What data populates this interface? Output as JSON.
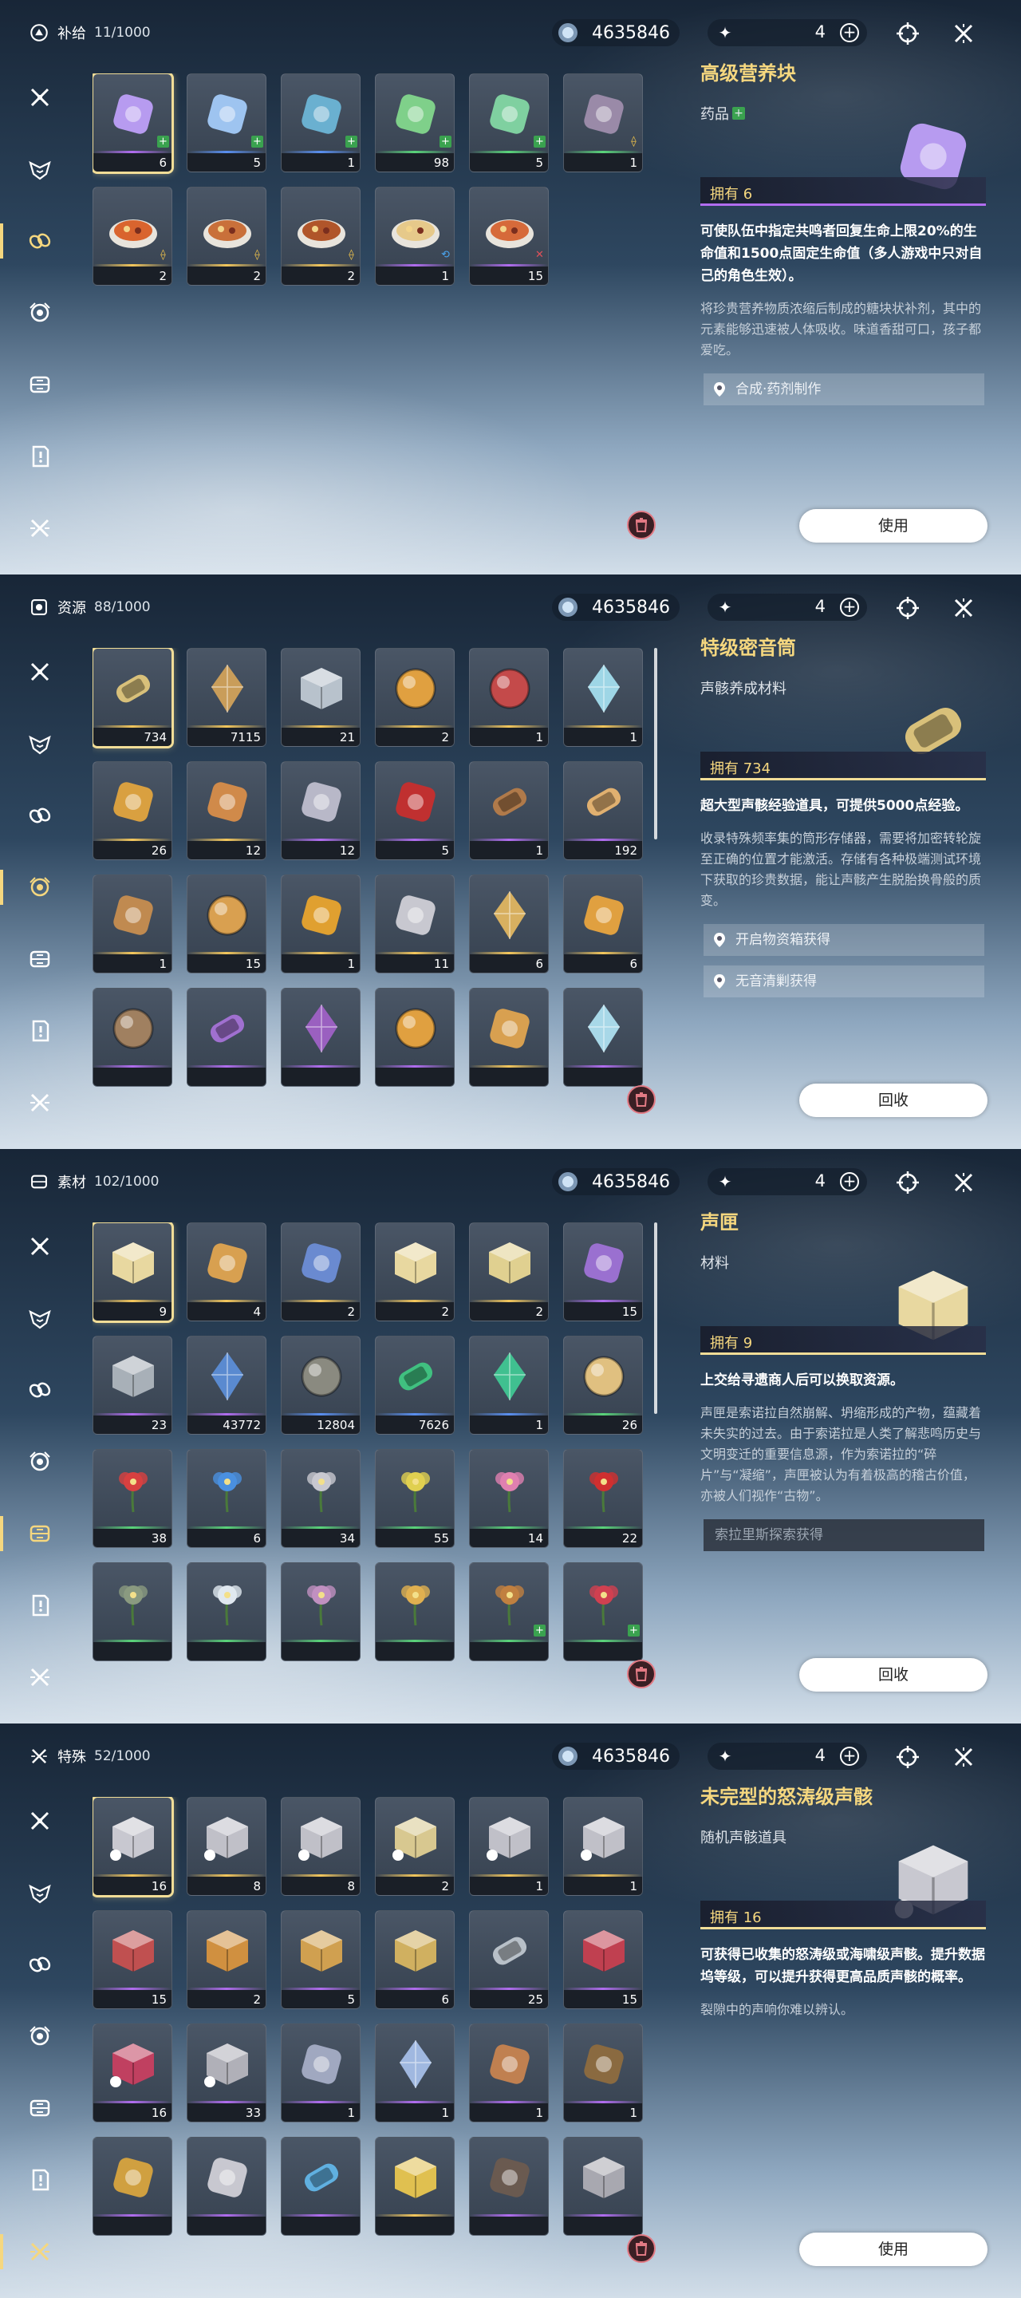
{
  "panels": [
    {
      "category": {
        "name": "补给",
        "count": "11/1000",
        "icon": "supply-icon"
      },
      "currency": {
        "credits": "4635846",
        "lunite": "4"
      },
      "active_tab": 2,
      "items": [
        {
          "icon": "purple-nutrient-block",
          "qty": "6",
          "rarity": 4,
          "badge": "plus",
          "color": "#b79bf0",
          "selected": true
        },
        {
          "icon": "blue-nutrient-block",
          "qty": "5",
          "rarity": 3,
          "badge": "plus",
          "color": "#9ec4f0"
        },
        {
          "icon": "medicine-pack",
          "qty": "1",
          "rarity": 3,
          "badge": "plus",
          "color": "#6ab0d0"
        },
        {
          "icon": "green-capsule",
          "qty": "98",
          "rarity": 2,
          "badge": "plus",
          "color": "#7fd08a"
        },
        {
          "icon": "green-nutrient-block",
          "qty": "5",
          "rarity": 2,
          "badge": "plus",
          "color": "#7fd0a0"
        },
        {
          "icon": "dark-gadget",
          "qty": "1",
          "rarity": 2,
          "badge": "coin",
          "color": "#9a8aa8"
        },
        {
          "icon": "spicy-dish",
          "qty": "2",
          "rarity": 5,
          "badge": "coin",
          "color": "#d9642e"
        },
        {
          "icon": "stir-fry-dish",
          "qty": "2",
          "rarity": 5,
          "badge": "coin",
          "color": "#c9703a"
        },
        {
          "icon": "meatball-dish",
          "qty": "2",
          "rarity": 5,
          "badge": "coin",
          "color": "#b0552a"
        },
        {
          "icon": "pastry-dish",
          "qty": "1",
          "rarity": 4,
          "badge": "blue",
          "color": "#e6c98a"
        },
        {
          "icon": "soup-dish",
          "qty": "15",
          "rarity": 4,
          "badge": "red",
          "color": "#d66a3a"
        }
      ],
      "detail": {
        "name": "高级营养块",
        "type": "药品",
        "type_plus": true,
        "owned": "拥有 6",
        "effect": "可使队伍中指定共鸣者回复生命上限20%的生命值和1500点固定生命值（多人游戏中只对自己的角色生效）。",
        "lore": "将珍贵营养物质浓缩后制成的糖块状补剂，其中的元素能够迅速被人体吸收。味道香甜可口，孩子都爱吃。",
        "sources": [
          {
            "label": "合成·药剂制作",
            "dark": false
          }
        ],
        "pic_color": "#b79bf0",
        "own_color": "purple"
      },
      "action": "使用",
      "show_scroll": false
    },
    {
      "category": {
        "name": "资源",
        "count": "88/1000",
        "icon": "resource-icon"
      },
      "currency": {
        "credits": "4635846",
        "lunite": "4"
      },
      "active_tab": 3,
      "items": [
        {
          "icon": "premium-sealed-tube",
          "qty": "734",
          "rarity": 5,
          "color": "#d8c07a",
          "selected": true
        },
        {
          "icon": "gold-crystal-gear",
          "qty": "7115",
          "rarity": 5,
          "color": "#c99d5a"
        },
        {
          "icon": "shell-credit-box",
          "qty": "21",
          "rarity": 5,
          "color": "#b8c2cc"
        },
        {
          "icon": "amber-orb",
          "qty": "2",
          "rarity": 5,
          "color": "#e0a040"
        },
        {
          "icon": "red-ring",
          "qty": "1",
          "rarity": 5,
          "color": "#c44a4a"
        },
        {
          "icon": "crystal-shard",
          "qty": "1",
          "rarity": 5,
          "color": "#9ed6e6"
        },
        {
          "icon": "gold-star-core",
          "qty": "26",
          "rarity": 5,
          "color": "#d9a040"
        },
        {
          "icon": "triangle-relic",
          "qty": "12",
          "rarity": 5,
          "color": "#d08a4a"
        },
        {
          "icon": "silver-crown",
          "qty": "12",
          "rarity": 4,
          "color": "#b8b8c8"
        },
        {
          "icon": "red-mechanism",
          "qty": "5",
          "rarity": 4,
          "color": "#c03030"
        },
        {
          "icon": "bronze-roll",
          "qty": "1",
          "rarity": 4,
          "color": "#b07a4a"
        },
        {
          "icon": "amber-vial",
          "qty": "192",
          "rarity": 4,
          "color": "#e0b070"
        },
        {
          "icon": "spiral-shell",
          "qty": "1",
          "rarity": 5,
          "color": "#c08a50"
        },
        {
          "icon": "flame-lens",
          "qty": "15",
          "rarity": 5,
          "color": "#d9a050"
        },
        {
          "icon": "golden-flame",
          "qty": "1",
          "rarity": 5,
          "color": "#e0a030"
        },
        {
          "icon": "silver-butterfly",
          "qty": "11",
          "rarity": 5,
          "color": "#c8c8d0"
        },
        {
          "icon": "gold-feather",
          "qty": "6",
          "rarity": 5,
          "color": "#d8b060"
        },
        {
          "icon": "gold-comet",
          "qty": "6",
          "rarity": 5,
          "color": "#e0a040"
        },
        {
          "icon": "bronze-disc",
          "qty": "",
          "rarity": 4,
          "color": "#a08060"
        },
        {
          "icon": "purple-tube",
          "qty": "",
          "rarity": 4,
          "color": "#a070d0"
        },
        {
          "icon": "violet-crystal",
          "qty": "",
          "rarity": 4,
          "color": "#9a60c0"
        },
        {
          "icon": "gold-sphere",
          "qty": "",
          "rarity": 4,
          "color": "#e0a040"
        },
        {
          "icon": "gold-spiral",
          "qty": "",
          "rarity": 5,
          "color": "#d8a050"
        },
        {
          "icon": "ice-crystal",
          "qty": "",
          "rarity": 4,
          "color": "#a8d8e8"
        }
      ],
      "detail": {
        "name": "特级密音筒",
        "type": "声骸养成材料",
        "type_plus": false,
        "owned": "拥有 734",
        "effect": "超大型声骸经验道具，可提供5000点经验。",
        "lore": "收录特殊频率集的筒形存储器，需要将加密转轮旋至正确的位置才能激活。存储有各种极端测试环境下获取的珍贵数据，能让声骸产生脱胎换骨般的质变。",
        "sources": [
          {
            "label": "开启物资箱获得",
            "dark": false
          },
          {
            "label": "无音清剿获得",
            "dark": false
          }
        ],
        "pic_color": "#d8c07a",
        "own_color": "gold"
      },
      "action": "回收",
      "show_scroll": true
    },
    {
      "category": {
        "name": "素材",
        "count": "102/1000",
        "icon": "material-icon"
      },
      "currency": {
        "credits": "4635846",
        "lunite": "4"
      },
      "active_tab": 4,
      "items": [
        {
          "icon": "sonance-casket",
          "qty": "9",
          "rarity": 5,
          "color": "#e8d8a0",
          "selected": true
        },
        {
          "icon": "gold-spark",
          "qty": "4",
          "rarity": 5,
          "color": "#d8a050"
        },
        {
          "icon": "tarot-card",
          "qty": "2",
          "rarity": 5,
          "color": "#6a8ad0"
        },
        {
          "icon": "light-cube",
          "qty": "2",
          "rarity": 5,
          "color": "#e8d8a0"
        },
        {
          "icon": "light-cube-small",
          "qty": "2",
          "rarity": 5,
          "color": "#e0d090"
        },
        {
          "icon": "violet-card",
          "qty": "15",
          "rarity": 4,
          "color": "#9a70d0"
        },
        {
          "icon": "iron-cube",
          "qty": "23",
          "rarity": 4,
          "color": "#a8b0b8"
        },
        {
          "icon": "blue-claw",
          "qty": "43772",
          "rarity": 4,
          "color": "#5a8ad0"
        },
        {
          "icon": "stone-orb",
          "qty": "12804",
          "rarity": 3,
          "color": "#8a8a80"
        },
        {
          "icon": "green-canister",
          "qty": "7626",
          "rarity": 3,
          "color": "#40c080"
        },
        {
          "icon": "green-pyramid",
          "qty": "1",
          "rarity": 3,
          "color": "#40c090"
        },
        {
          "icon": "eggs",
          "qty": "26",
          "rarity": 2,
          "color": "#e0c080"
        },
        {
          "icon": "red-fruit",
          "qty": "38",
          "rarity": 2,
          "color": "#d84040"
        },
        {
          "icon": "blue-flower",
          "qty": "6",
          "rarity": 2,
          "color": "#4a90e0"
        },
        {
          "icon": "white-sprout",
          "qty": "34",
          "rarity": 2,
          "color": "#c8c8d0"
        },
        {
          "icon": "yellow-bloom",
          "qty": "55",
          "rarity": 2,
          "color": "#e0d050"
        },
        {
          "icon": "pink-lily",
          "qty": "14",
          "rarity": 2,
          "color": "#e080b0"
        },
        {
          "icon": "red-rose",
          "qty": "22",
          "rarity": 2,
          "color": "#d03030"
        },
        {
          "icon": "lotus-leaf",
          "qty": "",
          "rarity": 2,
          "color": "#8a9a80"
        },
        {
          "icon": "white-daisy",
          "qty": "",
          "rarity": 2,
          "color": "#e0e8f0"
        },
        {
          "icon": "coral-branch",
          "qty": "",
          "rarity": 2,
          "color": "#c090c0"
        },
        {
          "icon": "golden-bulb",
          "qty": "",
          "rarity": 2,
          "color": "#e0b050"
        },
        {
          "icon": "wild-grass",
          "qty": "",
          "rarity": 2,
          "badge": "plus",
          "color": "#c08040"
        },
        {
          "icon": "berry-sprig",
          "qty": "",
          "rarity": 2,
          "badge": "plus",
          "color": "#d04050"
        }
      ],
      "detail": {
        "name": "声匣",
        "type": "材料",
        "type_plus": false,
        "owned": "拥有 9",
        "effect": "上交给寻遗商人后可以换取资源。",
        "lore": "声匣是索诺拉自然崩解、坍缩形成的产物，蕴藏着未失实的过去。由于索诺拉是人类了解悲鸣历史与文明变迁的重要信息源，作为索诺拉的“碎片”与“凝缩”，声匣被认为有着极高的稽古价值，亦被人们视作“古物”。",
        "sources": [
          {
            "label": "索拉里斯探索获得",
            "dark": true
          }
        ],
        "pic_color": "#e8d8a0",
        "own_color": "gold"
      },
      "action": "回收",
      "show_scroll": true
    },
    {
      "category": {
        "name": "特殊",
        "count": "52/1000",
        "icon": "special-icon"
      },
      "currency": {
        "credits": "4635846",
        "lunite": "4"
      },
      "active_tab": 6,
      "items": [
        {
          "icon": "tacet-cube-crowned",
          "qty": "16",
          "rarity": 5,
          "color": "#c8c8d0",
          "selected": true
        },
        {
          "icon": "tacet-cube",
          "qty": "8",
          "rarity": 5,
          "color": "#c0c0c8"
        },
        {
          "icon": "tacet-cube",
          "qty": "8",
          "rarity": 5,
          "color": "#c0c0c8"
        },
        {
          "icon": "tacet-cube-gold",
          "qty": "2",
          "rarity": 5,
          "color": "#d8c890"
        },
        {
          "icon": "tacet-cube",
          "qty": "1",
          "rarity": 5,
          "color": "#c0c0c8"
        },
        {
          "icon": "tacet-cube",
          "qty": "1",
          "rarity": 5,
          "color": "#c0c0c8"
        },
        {
          "icon": "red-crate",
          "qty": "15",
          "rarity": 4,
          "color": "#c05050"
        },
        {
          "icon": "amber-crate",
          "qty": "2",
          "rarity": 4,
          "color": "#d09040"
        },
        {
          "icon": "gold-crate",
          "qty": "5",
          "rarity": 4,
          "color": "#d0a050"
        },
        {
          "icon": "gift-cage",
          "qty": "6",
          "rarity": 4,
          "color": "#d0b060"
        },
        {
          "icon": "silver-cylinder",
          "qty": "25",
          "rarity": 4,
          "color": "#b8c0c8"
        },
        {
          "icon": "red-crate-b",
          "qty": "15",
          "rarity": 4,
          "color": "#c04050"
        },
        {
          "icon": "red-tacet-box",
          "qty": "16",
          "rarity": 4,
          "color": "#c04060"
        },
        {
          "icon": "tacet-box",
          "qty": "33",
          "rarity": 4,
          "color": "#b0b0b8"
        },
        {
          "icon": "recycle-card",
          "qty": "1",
          "rarity": 4,
          "color": "#a0a8c0"
        },
        {
          "icon": "crystal-blade",
          "qty": "1",
          "rarity": 4,
          "color": "#a0b8e0"
        },
        {
          "icon": "birthday-cake",
          "qty": "1",
          "rarity": 4,
          "color": "#c08050"
        },
        {
          "icon": "dark-crown",
          "qty": "1",
          "rarity": 4,
          "color": "#8a6a40"
        },
        {
          "icon": "gold-crown",
          "qty": "",
          "rarity": 4,
          "color": "#d0a040"
        },
        {
          "icon": "silver-mask",
          "qty": "",
          "rarity": 4,
          "color": "#c8c8d0"
        },
        {
          "icon": "crystal-vial",
          "qty": "",
          "rarity": 4,
          "color": "#60b0e0"
        },
        {
          "icon": "gold-box",
          "qty": "",
          "rarity": 5,
          "color": "#e0c050"
        },
        {
          "icon": "dark-jar",
          "qty": "",
          "rarity": 4,
          "color": "#6a5a50"
        },
        {
          "icon": "triangle-case",
          "qty": "",
          "rarity": 4,
          "color": "#a8a8b0"
        }
      ],
      "detail": {
        "name": "未完型的怒涛级声骸",
        "type": "随机声骸道具",
        "type_plus": false,
        "owned": "拥有 16",
        "effect": "可获得已收集的怒涛级或海啸级声骸。提升数据坞等级，可以提升获得更高品质声骸的概率。",
        "lore": "裂隙中的声响你难以辨认。",
        "sources": [],
        "pic_color": "#c8c8d0",
        "own_color": "gold"
      },
      "action": "使用",
      "show_scroll": false
    }
  ],
  "tab_icons": [
    "crossed-swords-icon",
    "echo-mask-icon",
    "chain-link-icon",
    "gear-ring-icon",
    "materials-box-icon",
    "quest-item-icon",
    "special-icon"
  ]
}
